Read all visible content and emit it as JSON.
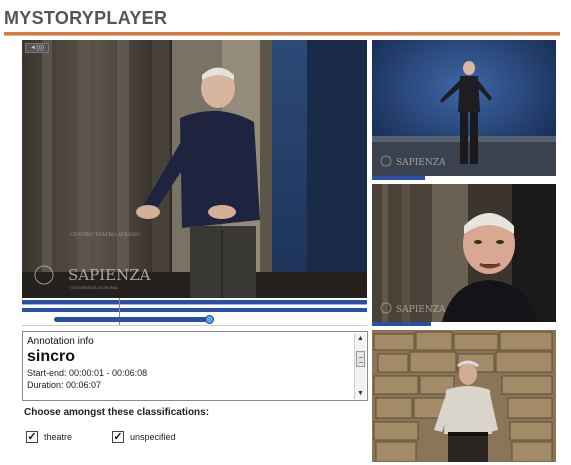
{
  "app": {
    "title": "MYSTORYPLAYER"
  },
  "main_video": {
    "badge": "◄))))",
    "watermark": "SAPIENZA",
    "watermark_small": "CENTRO TEATRO ATENEO",
    "watermark_sub": "UNIVERSITÀ DI ROMA"
  },
  "timeline": {
    "progress_fraction": 0.55,
    "cursor_fraction": 0.28
  },
  "annotation": {
    "heading": "Annotation info",
    "name": "sincro",
    "start_end": "Start-end: 00:00:01 - 00:06:08",
    "duration": "Duration: 00:06:07",
    "scroll_up": "▲",
    "scroll_down": "▼"
  },
  "classifications": {
    "label": "Choose amongst these classifications:",
    "items": [
      {
        "label": "theatre",
        "checked": true,
        "mark": "✓"
      },
      {
        "label": "unspecified",
        "checked": true,
        "mark": "✓"
      }
    ]
  },
  "thumbnails": [
    {
      "watermark": "SAPIENZA",
      "progress_fraction": 0.29
    },
    {
      "watermark": "SAPIENZA",
      "progress_fraction": 0.32
    },
    {
      "watermark": "",
      "progress_fraction": 0
    }
  ],
  "colors": {
    "accent": "#e07a2f",
    "timeline": "#2b4ea6"
  }
}
